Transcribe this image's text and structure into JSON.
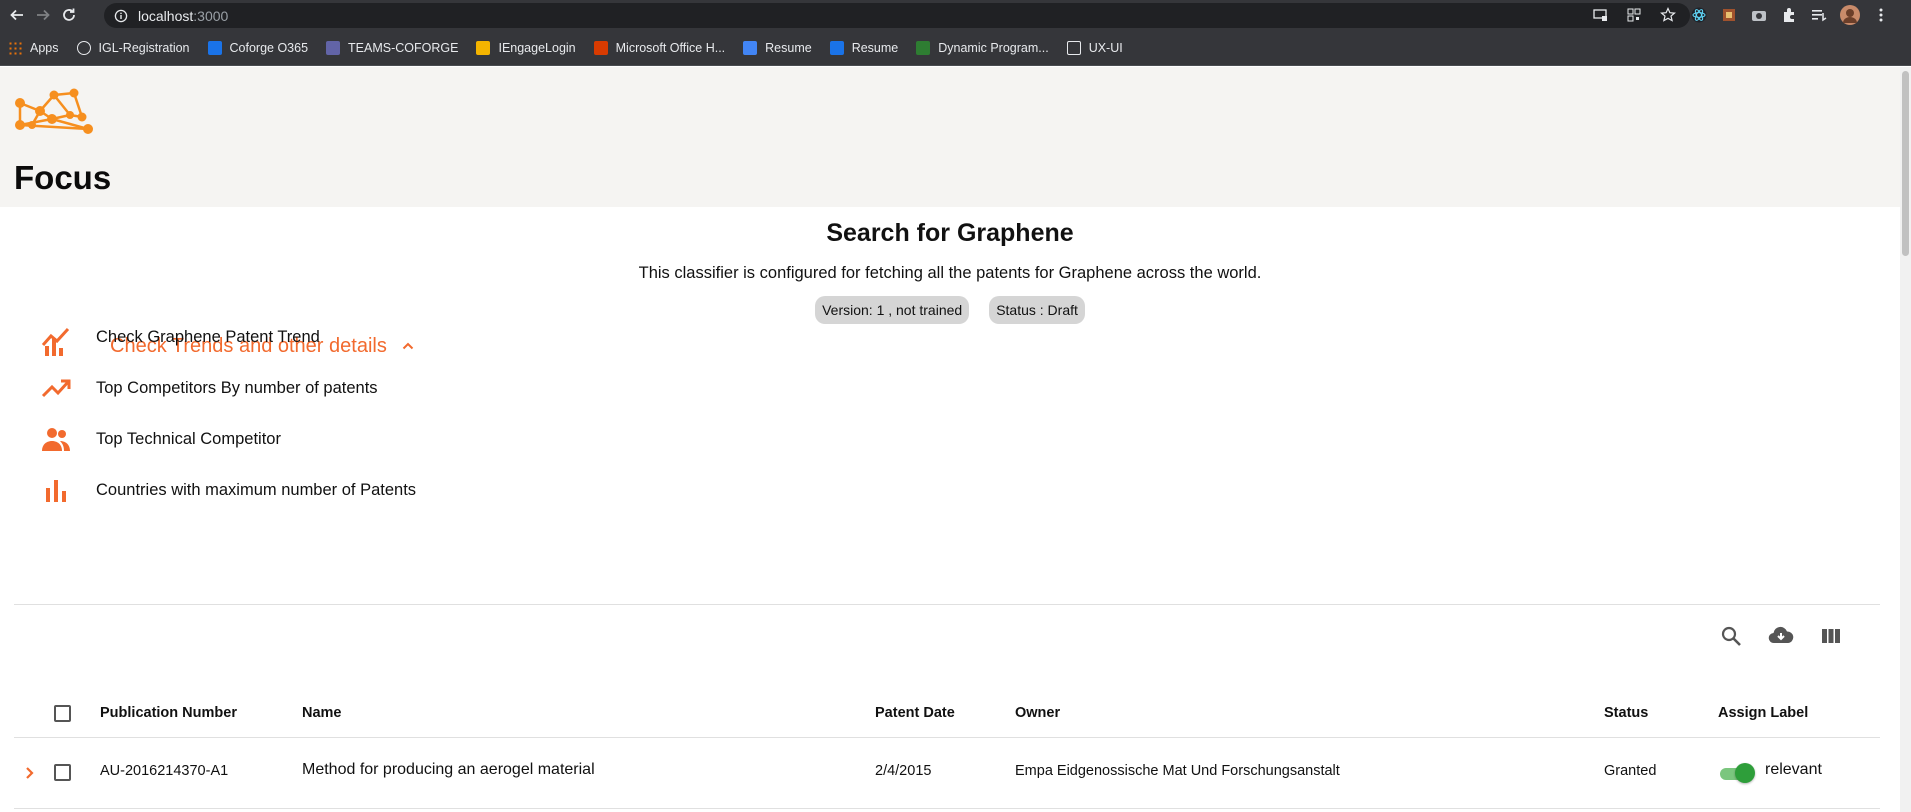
{
  "browser": {
    "url_host": "localhost",
    "url_port": ":3000",
    "bookmarks": [
      {
        "label": "Apps",
        "icon": "apps-grid-icon",
        "color": "#e8710a"
      },
      {
        "label": "IGL-Registration",
        "icon": "globe-icon",
        "color": "#e8eaed"
      },
      {
        "label": "Coforge O365",
        "icon": "outlook-icon",
        "color": "#1a73e8"
      },
      {
        "label": "TEAMS-COFORGE",
        "icon": "teams-icon",
        "color": "#6264a7"
      },
      {
        "label": "IEngageLogin",
        "icon": "iengage-icon",
        "color": "#f4b400"
      },
      {
        "label": "Microsoft Office H...",
        "icon": "office-icon",
        "color": "#d83b01"
      },
      {
        "label": "Resume",
        "icon": "resume-doc-icon",
        "color": "#4285f4"
      },
      {
        "label": "Resume",
        "icon": "resume-m-icon",
        "color": "#1a73e8"
      },
      {
        "label": "Dynamic Program...",
        "icon": "dynamic-icon",
        "color": "#2e7d32"
      },
      {
        "label": "UX-UI",
        "icon": "folder-icon",
        "color": "#e8eaed"
      }
    ]
  },
  "app": {
    "title": "Focus",
    "accent": "#f26a2e"
  },
  "classifier": {
    "title": "Search for Graphene",
    "description": "This classifier is configured for fetching all the patents for Graphene across the world.",
    "version_chip": "Version: 1 , not trained",
    "status_chip": "Status : Draft"
  },
  "trends": {
    "label": "Check Trends and other details",
    "items": [
      {
        "label": "Check Graphene Patent Trend",
        "icon": "trend-line-icon"
      },
      {
        "label": "Top Competitors By number of patents",
        "icon": "trending-up-icon"
      },
      {
        "label": "Top Technical Competitor",
        "icon": "people-icon"
      },
      {
        "label": "Countries with maximum number of Patents",
        "icon": "bar-chart-icon"
      }
    ]
  },
  "table": {
    "toolbar": [
      "search-icon",
      "cloud-download-icon",
      "view-columns-icon"
    ],
    "columns": {
      "publication_number": "Publication Number",
      "name": "Name",
      "patent_date": "Patent Date",
      "owner": "Owner",
      "status": "Status",
      "assign_label": "Assign Label"
    },
    "rows": [
      {
        "publication_number": "AU-2016214370-A1",
        "name": "Method for producing an aerogel material",
        "patent_date": "2/4/2015",
        "owner": "Empa Eidgenossische Mat Und Forschungsanstalt",
        "status": "Granted",
        "label": "relevant",
        "label_on": true
      }
    ]
  }
}
